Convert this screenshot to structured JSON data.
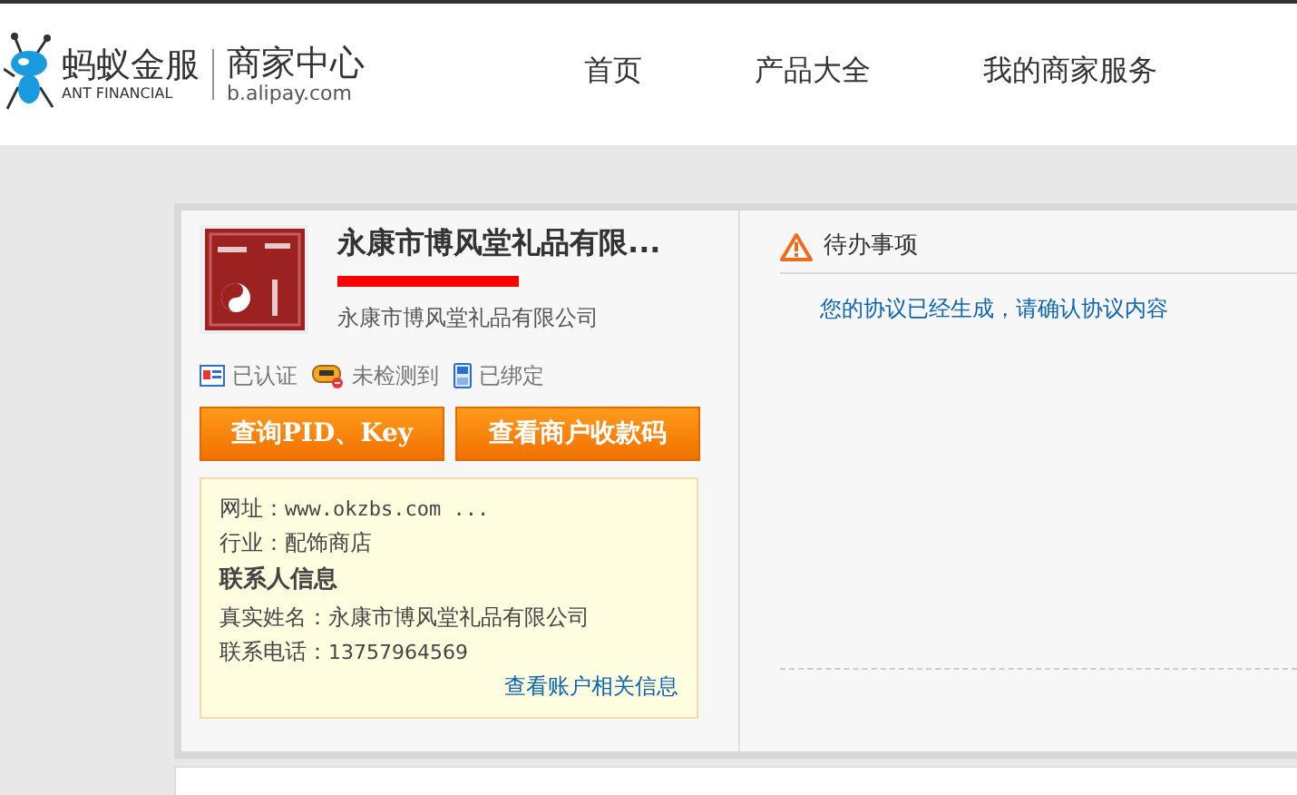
{
  "header": {
    "brand": "蚂蚁金服",
    "brand_en": "ANT FINANCIAL",
    "site": "商家中心",
    "site_url": "b.alipay.com",
    "nav": [
      {
        "label": "首页"
      },
      {
        "label": "产品大全"
      },
      {
        "label": "我的商家服务"
      }
    ]
  },
  "merchant": {
    "title": "永康市博风堂礼品有限...",
    "company": "永康市博风堂礼品有限公司",
    "statuses": [
      {
        "kind": "id",
        "label": "已认证"
      },
      {
        "kind": "device",
        "label": "未检测到"
      },
      {
        "kind": "phone",
        "label": "已绑定"
      }
    ],
    "buttons": [
      {
        "label": "查询PID、Key"
      },
      {
        "label": "查看商户收款码"
      }
    ],
    "info": {
      "website_label": "网址：",
      "website": "www.okzbs.com ...",
      "industry_label": "行业：",
      "industry": "配饰商店",
      "contact_heading": "联系人信息",
      "name_label": "真实姓名：",
      "name": "永康市博风堂礼品有限公司",
      "phone_label": "联系电话：",
      "phone": "13757964569",
      "link": "查看账户相关信息"
    }
  },
  "todo": {
    "title": "待办事项",
    "items": [
      {
        "text": "您的协议已经生成，请确认协议内容"
      }
    ]
  }
}
